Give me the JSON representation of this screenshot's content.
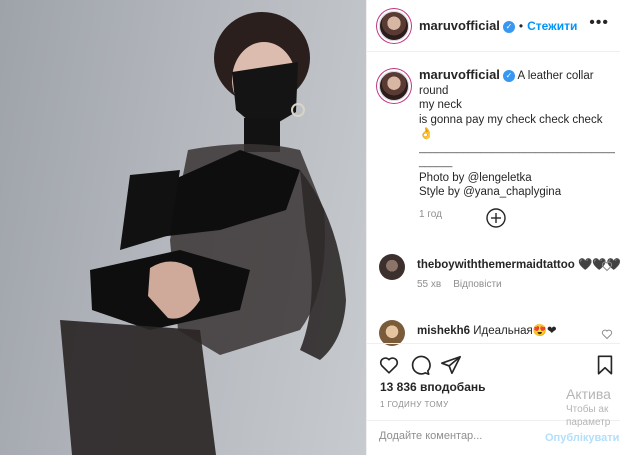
{
  "header": {
    "username": "maruvofficial",
    "verified_mark": "✓",
    "separator": "•",
    "follow_label": "Стежити",
    "more_icon": "•••"
  },
  "caption": {
    "username": "maruvofficial",
    "line1": "A leather collar round",
    "line2": "my neck",
    "line3": "is gonna pay my check check check",
    "emoji": "👌",
    "divider": "____________________________________",
    "divider2": "______",
    "photo_credit": "Photo by @lengeletka",
    "style_credit": "Style by @yana_chaplygina",
    "time_ago": "1 год"
  },
  "comments": [
    {
      "username": "theboywiththemermaidtattoo",
      "text": "🖤🖤🖤",
      "time": "55 хв",
      "reply_label": "Відповісти"
    },
    {
      "username": "mishekh6",
      "text": "Идеальная😍❤"
    }
  ],
  "post": {
    "likes": "13 836 вподобань",
    "timestamp": "1 ГОДИНУ ТОМУ"
  },
  "add_comment": {
    "placeholder": "Додайте коментар...",
    "publish_label": "Опублікувати"
  },
  "activation_overlay": {
    "line1": "Актива",
    "line2": "Чтобы ак",
    "line3": "параметр"
  },
  "icons": {
    "like": "heart-icon",
    "comment": "comment-icon",
    "share": "share-icon",
    "save": "bookmark-icon",
    "load_more": "plus-circle-icon"
  },
  "colors": {
    "link_blue": "#0095f6",
    "verified_blue": "#3897f0",
    "muted": "#8e8e8e",
    "border": "#efefef",
    "story_ring": "#c13584"
  }
}
